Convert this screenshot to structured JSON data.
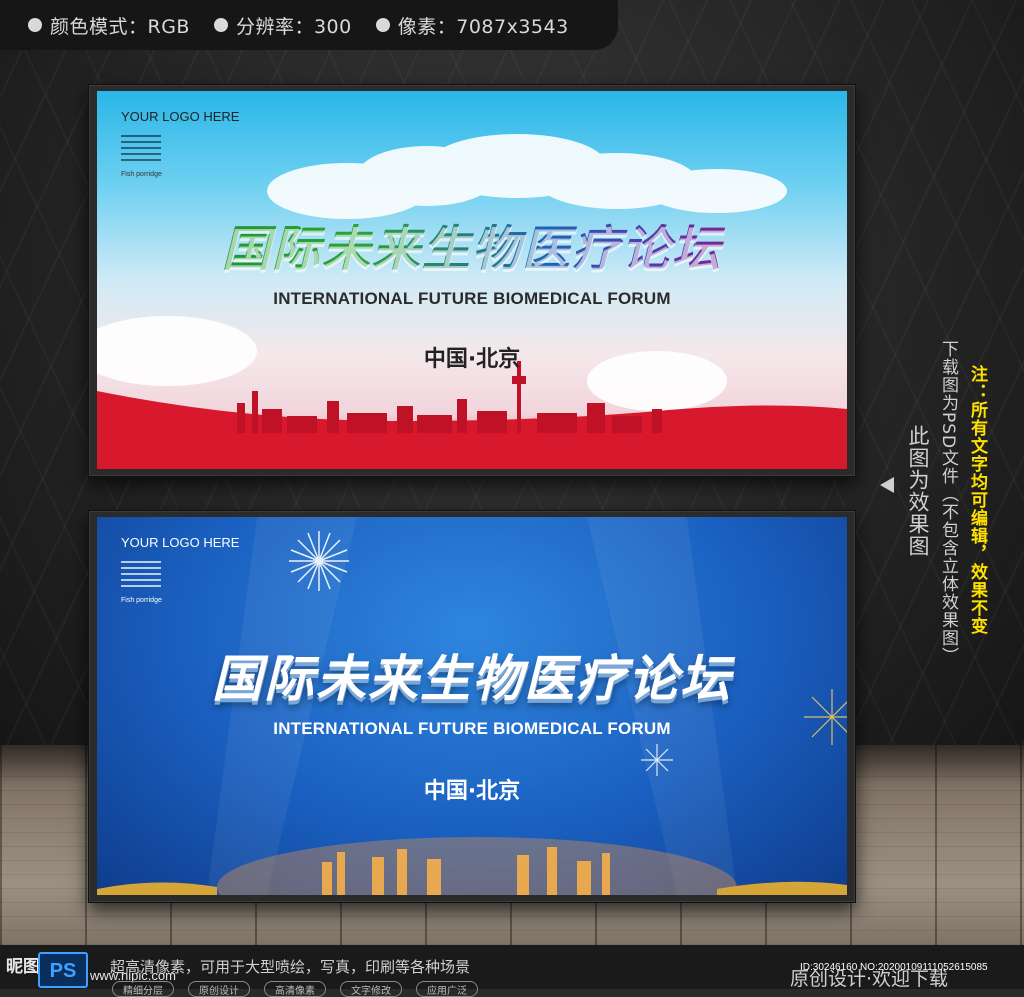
{
  "infobar": {
    "items": [
      {
        "label": "颜色模式：RGB"
      },
      {
        "label": "分辨率：300"
      },
      {
        "label": "像素：7087x3543"
      }
    ]
  },
  "banner_top": {
    "logo": "YOUR LOGO HERE",
    "tiny_caption": "Fish porridge",
    "cn_title": "国际未来生物医疗论坛",
    "en_title": "INTERNATIONAL FUTURE BIOMEDICAL FORUM",
    "location": "中国·北京"
  },
  "banner_bottom": {
    "logo": "YOUR LOGO HERE",
    "tiny_caption": "Fish porridge",
    "cn_title": "国际未来生物医疗论坛",
    "en_title": "INTERNATIONAL FUTURE BIOMEDICAL FORUM",
    "location": "中国·北京"
  },
  "side_notes": {
    "note": "注：所有文字均可编辑，效果不变",
    "psd": "下载图为PSD文件（不包含立体效果图）",
    "effect": "此图为效果图"
  },
  "bottom": {
    "site_logo": "昵图网",
    "site_url": "www.nipic.com",
    "ps_label": "PS",
    "hd_text": "超高清像素，可用于大型喷绘，写真，印刷等各种场景",
    "tags": [
      "精细分层",
      "原创设计",
      "高清像素",
      "文字修改",
      "应用广泛"
    ],
    "original_text": "原创设计·欢迎下载",
    "id_text": "ID:30246160 NO:20200109111052615085"
  },
  "colors": {
    "note_yellow": "#ffe100",
    "banner_red": "#d8192d",
    "banner_blue": "#1a5fbf"
  }
}
